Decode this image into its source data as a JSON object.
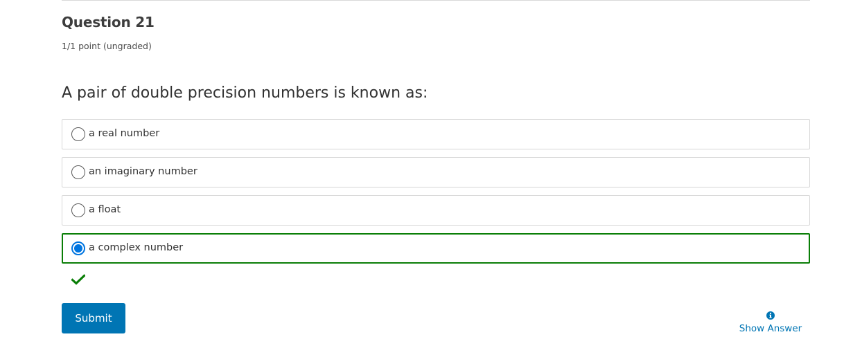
{
  "question": {
    "title": "Question 21",
    "points": "1/1 point (ungraded)",
    "prompt": "A pair of double precision numbers is known as:"
  },
  "choices": [
    {
      "label": "a real number",
      "selected": false
    },
    {
      "label": "an imaginary number",
      "selected": false
    },
    {
      "label": "a float",
      "selected": false
    },
    {
      "label": "a complex number",
      "selected": true
    }
  ],
  "feedback": {
    "icon": "checkmark-icon",
    "color": "#0a7e07"
  },
  "actions": {
    "submit_label": "Submit",
    "show_answer_label": "Show Answer",
    "show_answer_icon": "info-icon"
  },
  "colors": {
    "accent": "#0075b4",
    "correct": "#0a7e07",
    "radio_selected": "#0075e0"
  }
}
